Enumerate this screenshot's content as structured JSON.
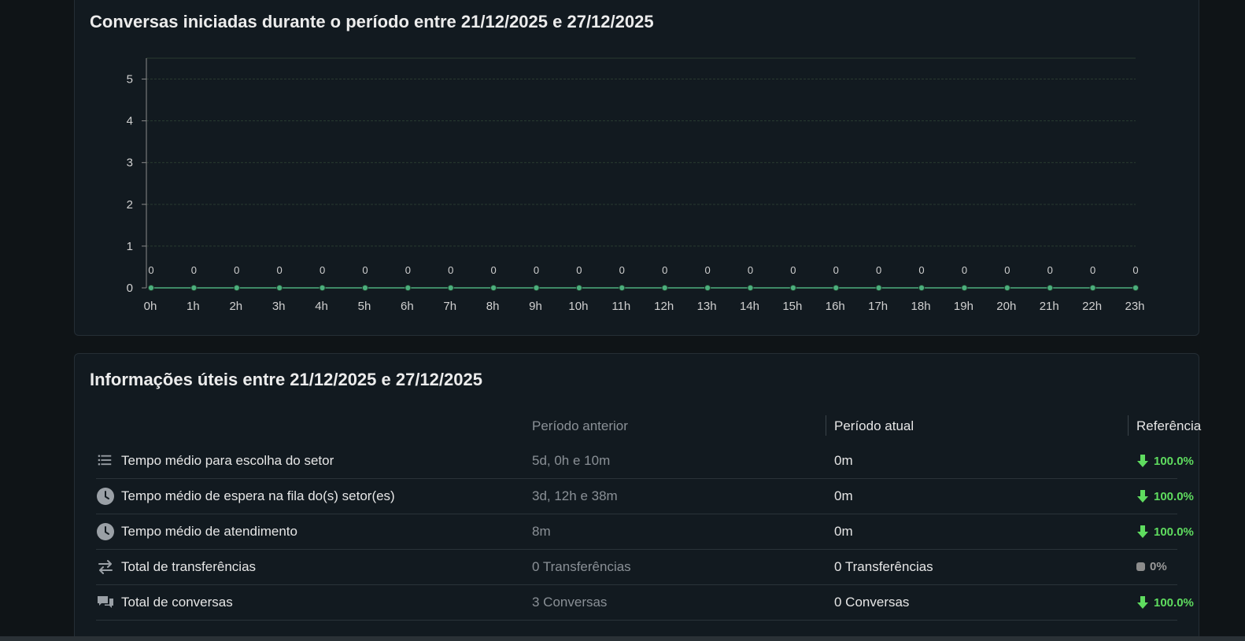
{
  "chart_card": {
    "title": "Conversas iniciadas durante o período entre 21/12/2025 e 27/12/2025"
  },
  "chart_data": {
    "type": "line",
    "title": "Conversas iniciadas durante o período entre 21/12/2025 e 27/12/2025",
    "x": [
      "0h",
      "1h",
      "2h",
      "3h",
      "4h",
      "5h",
      "6h",
      "7h",
      "8h",
      "9h",
      "10h",
      "11h",
      "12h",
      "13h",
      "14h",
      "15h",
      "16h",
      "17h",
      "18h",
      "19h",
      "20h",
      "21h",
      "22h",
      "23h"
    ],
    "values": [
      0,
      0,
      0,
      0,
      0,
      0,
      0,
      0,
      0,
      0,
      0,
      0,
      0,
      0,
      0,
      0,
      0,
      0,
      0,
      0,
      0,
      0,
      0,
      0
    ],
    "data_labels": [
      "0",
      "0",
      "0",
      "0",
      "0",
      "0",
      "0",
      "0",
      "0",
      "0",
      "0",
      "0",
      "0",
      "0",
      "0",
      "0",
      "0",
      "0",
      "0",
      "0",
      "0",
      "0",
      "0",
      "0"
    ],
    "yticks": [
      0,
      1,
      2,
      3,
      4,
      5
    ],
    "ylim": [
      0,
      5.5
    ],
    "grid": true,
    "legend": "none",
    "colors": {
      "line": "#4caf7d",
      "point": "#4caf7d",
      "grid": "#2a3a30",
      "text": "#d0d0d0"
    }
  },
  "info_card": {
    "title": "Informações úteis entre 21/12/2025 e 27/12/2025",
    "headers": {
      "previous": "Período anterior",
      "current": "Período atual",
      "reference": "Referência"
    },
    "rows": [
      {
        "icon": "list-icon",
        "label": "Tempo médio para escolha do setor",
        "previous": "5d, 0h e 10m",
        "current": "0m",
        "reference": "100.0%",
        "trend": "down"
      },
      {
        "icon": "clock-icon",
        "label": "Tempo médio de espera na fila do(s) setor(es)",
        "previous": "3d, 12h e 38m",
        "current": "0m",
        "reference": "100.0%",
        "trend": "down"
      },
      {
        "icon": "clock-icon",
        "label": "Tempo médio de atendimento",
        "previous": "8m",
        "current": "0m",
        "reference": "100.0%",
        "trend": "down"
      },
      {
        "icon": "transfer-icon",
        "label": "Total de transferências",
        "previous": "0 Transferências",
        "current": "0 Transferências",
        "reference": "0%",
        "trend": "neutral"
      },
      {
        "icon": "chat-icon",
        "label": "Total de conversas",
        "previous": "3 Conversas",
        "current": "0 Conversas",
        "reference": "100.0%",
        "trend": "down"
      }
    ],
    "colors": {
      "down": "#5fdc5f",
      "neutral": "#9a9a9a"
    }
  }
}
